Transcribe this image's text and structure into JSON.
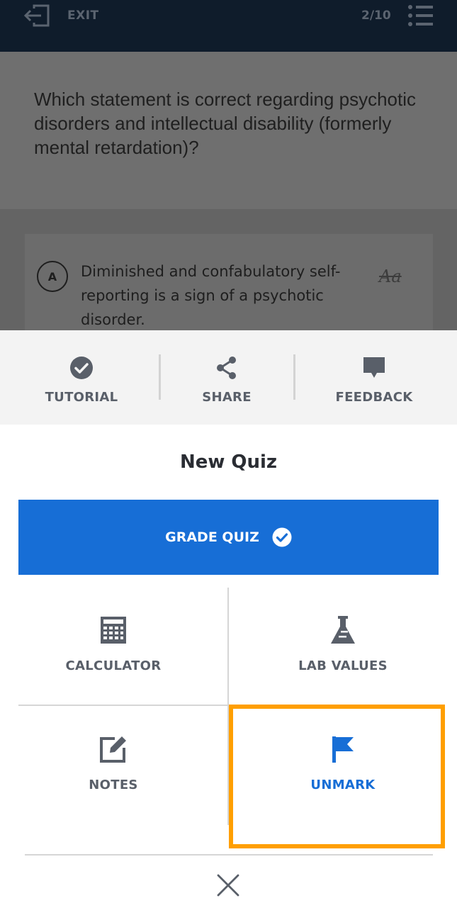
{
  "topbar": {
    "exit_label": "EXIT",
    "progress": "2/10",
    "icons": {
      "exit": "exit-door-icon",
      "list": "list-icon"
    }
  },
  "question": {
    "text": "Which statement is correct regarding psychotic disorders and intellectual disability (formerly mental retardation)?"
  },
  "answers": [
    {
      "letter": "A",
      "text": "Diminished and confabulatory self-reporting is a sign of a psychotic disorder.",
      "strike_icon": "Aa"
    }
  ],
  "sheet_actions": [
    {
      "label": "TUTORIAL",
      "icon": "check-circle-icon"
    },
    {
      "label": "SHARE",
      "icon": "share-icon"
    },
    {
      "label": "FEEDBACK",
      "icon": "speech-bubble-icon"
    }
  ],
  "quiz_title": "New Quiz",
  "grade_button": {
    "label": "GRADE QUIZ",
    "icon": "check-circle-icon"
  },
  "tools": [
    {
      "label": "CALCULATOR",
      "icon": "calculator-icon"
    },
    {
      "label": "LAB VALUES",
      "icon": "flask-icon"
    },
    {
      "label": "NOTES",
      "icon": "edit-note-icon"
    },
    {
      "label": "UNMARK",
      "icon": "flag-icon"
    }
  ],
  "colors": {
    "accent_blue": "#176ed6",
    "highlight": "#ff9f00",
    "tool_gray": "#595f69",
    "topbar": "#0f1c2b"
  },
  "close_icon": "close-icon"
}
